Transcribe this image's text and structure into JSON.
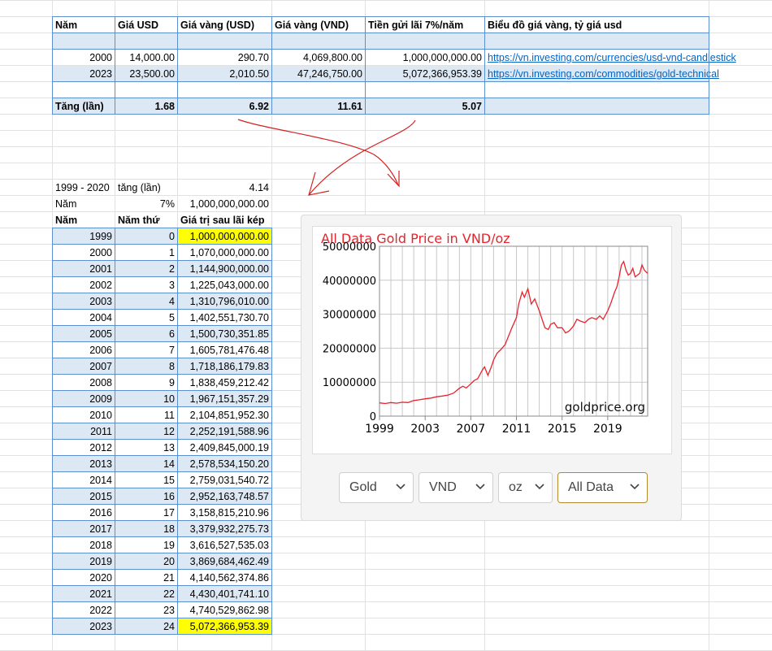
{
  "top_table": {
    "headers": [
      "Năm",
      "Giá USD",
      "Giá vàng (USD)",
      "Giá vàng (VND)",
      "Tiền gửi lãi 7%/năm",
      "Biểu đồ giá vàng, tỷ giá usd"
    ],
    "rows": [
      {
        "year": "2000",
        "usd": "14,000.00",
        "gold_usd": "290.70",
        "gold_vnd": "4,069,800.00",
        "deposit": "1,000,000,000.00",
        "link": "https://vn.investing.com/currencies/usd-vnd-candlestick"
      },
      {
        "year": "2023",
        "usd": "23,500.00",
        "gold_usd": "2,010.50",
        "gold_vnd": "47,246,750.00",
        "deposit": "5,072,366,953.39",
        "link": "https://vn.investing.com/commodities/gold-technical"
      }
    ],
    "increase": {
      "label": "Tăng (lần)",
      "usd": "1.68",
      "gold_usd": "6.92",
      "gold_vnd": "11.61",
      "deposit": "5.07"
    }
  },
  "params": {
    "range_label": "1999 - 2020",
    "increase_label": "tăng (lần)",
    "increase_value": "4.14",
    "year_label": "Năm",
    "rate": "7%",
    "principal": "1,000,000,000.00"
  },
  "compound_table": {
    "headers": [
      "Năm",
      "Năm thứ",
      "Giá trị sau lãi kép"
    ],
    "rows": [
      [
        "1999",
        "0",
        "1,000,000,000.00"
      ],
      [
        "2000",
        "1",
        "1,070,000,000.00"
      ],
      [
        "2001",
        "2",
        "1,144,900,000.00"
      ],
      [
        "2002",
        "3",
        "1,225,043,000.00"
      ],
      [
        "2003",
        "4",
        "1,310,796,010.00"
      ],
      [
        "2004",
        "5",
        "1,402,551,730.70"
      ],
      [
        "2005",
        "6",
        "1,500,730,351.85"
      ],
      [
        "2006",
        "7",
        "1,605,781,476.48"
      ],
      [
        "2007",
        "8",
        "1,718,186,179.83"
      ],
      [
        "2008",
        "9",
        "1,838,459,212.42"
      ],
      [
        "2009",
        "10",
        "1,967,151,357.29"
      ],
      [
        "2010",
        "11",
        "2,104,851,952.30"
      ],
      [
        "2011",
        "12",
        "2,252,191,588.96"
      ],
      [
        "2012",
        "13",
        "2,409,845,000.19"
      ],
      [
        "2013",
        "14",
        "2,578,534,150.20"
      ],
      [
        "2014",
        "15",
        "2,759,031,540.72"
      ],
      [
        "2015",
        "16",
        "2,952,163,748.57"
      ],
      [
        "2016",
        "17",
        "3,158,815,210.96"
      ],
      [
        "2017",
        "18",
        "3,379,932,275.73"
      ],
      [
        "2018",
        "19",
        "3,616,527,535.03"
      ],
      [
        "2019",
        "20",
        "3,869,684,462.49"
      ],
      [
        "2020",
        "21",
        "4,140,562,374.86"
      ],
      [
        "2021",
        "22",
        "4,430,401,741.10"
      ],
      [
        "2022",
        "23",
        "4,740,529,862.98"
      ],
      [
        "2023",
        "24",
        "5,072,366,953.39"
      ]
    ]
  },
  "chart": {
    "title": "All Data Gold Price in VND/oz",
    "watermark": "goldprice.org",
    "title_color": "#e8232c",
    "line_color": "#e8232c",
    "dropdowns": [
      "Gold",
      "VND",
      "oz",
      "All Data"
    ]
  },
  "chart_data": {
    "type": "line",
    "title": "All Data Gold Price in VND/oz",
    "xlabel": "",
    "ylabel": "",
    "xlim": [
      1999,
      2022.5
    ],
    "ylim": [
      0,
      50000000
    ],
    "x_ticks": [
      "1999",
      "2003",
      "2007",
      "2011",
      "2015",
      "2019"
    ],
    "y_ticks": [
      "0",
      "10000000",
      "20000000",
      "30000000",
      "40000000",
      "50000000"
    ],
    "grid": true,
    "series": [
      {
        "x": [
          1999,
          1999.5,
          2000,
          2000.5,
          2001,
          2001.5,
          2002,
          2002.5,
          2003,
          2003.5,
          2004,
          2004.5,
          2005,
          2005.5,
          2006,
          2006.3,
          2006.6,
          2007,
          2007.3,
          2007.6,
          2008,
          2008.2,
          2008.5,
          2008.8,
          2009,
          2009.3,
          2009.6,
          2010,
          2010.3,
          2010.6,
          2011,
          2011.2,
          2011.5,
          2011.7,
          2012,
          2012.3,
          2012.6,
          2013,
          2013.2,
          2013.5,
          2013.8,
          2014,
          2014.3,
          2014.6,
          2015,
          2015.3,
          2015.6,
          2016,
          2016.3,
          2016.6,
          2017,
          2017.3,
          2017.6,
          2018,
          2018.3,
          2018.6,
          2019,
          2019.3,
          2019.6,
          2019.8,
          2020,
          2020.2,
          2020.4,
          2020.6,
          2020.8,
          2021,
          2021.2,
          2021.4,
          2021.6,
          2021.8,
          2022,
          2022.2,
          2022.5
        ],
        "y": [
          3900000,
          3700000,
          4000000,
          3800000,
          4100000,
          4000000,
          4600000,
          4800000,
          5100000,
          5300000,
          5700000,
          5900000,
          6200000,
          6800000,
          8200000,
          8800000,
          8300000,
          9500000,
          10500000,
          11000000,
          13500000,
          14500000,
          12000000,
          14500000,
          16500000,
          18500000,
          19500000,
          21000000,
          23500000,
          26000000,
          29000000,
          33000000,
          36500000,
          35000000,
          37500000,
          33000000,
          34500000,
          31000000,
          29000000,
          26000000,
          25500000,
          27000000,
          27500000,
          26000000,
          26000000,
          24500000,
          25000000,
          26500000,
          28500000,
          28000000,
          27500000,
          28500000,
          29000000,
          28500000,
          29500000,
          28500000,
          31000000,
          33500000,
          36500000,
          38000000,
          41000000,
          44500000,
          45500000,
          43000000,
          41500000,
          42000000,
          43500000,
          41000000,
          41500000,
          42000000,
          44500000,
          43000000,
          42000000
        ]
      }
    ]
  }
}
